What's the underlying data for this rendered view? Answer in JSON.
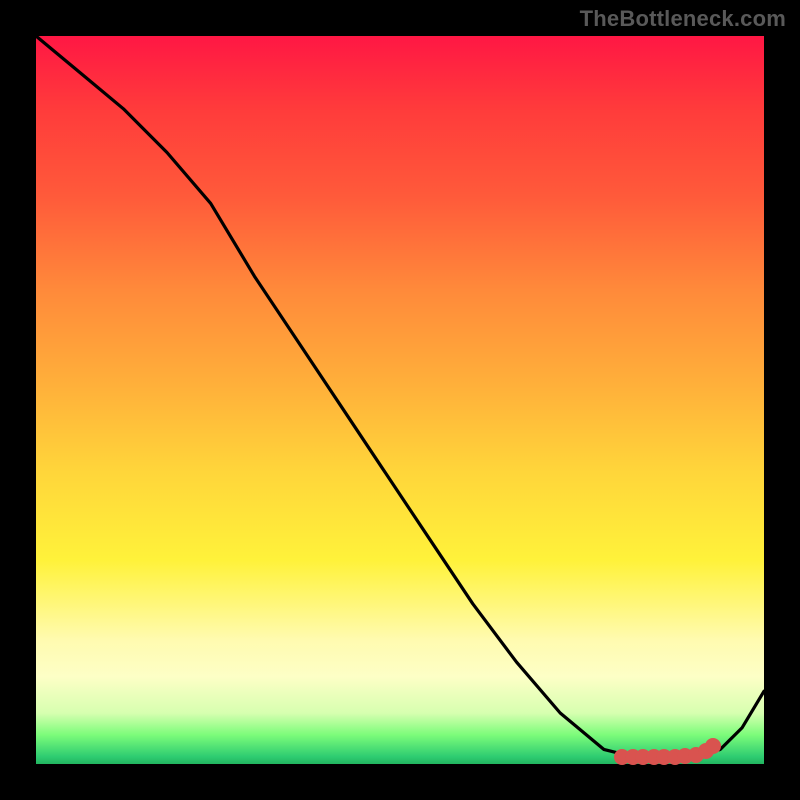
{
  "watermark": "TheBottleneck.com",
  "chart_data": {
    "type": "line",
    "title": "",
    "xlabel": "",
    "ylabel": "",
    "xlim": [
      0,
      100
    ],
    "ylim": [
      0,
      100
    ],
    "x": [
      0,
      6,
      12,
      18,
      24,
      30,
      36,
      42,
      48,
      54,
      60,
      66,
      72,
      78,
      82,
      86,
      90,
      94,
      97,
      100
    ],
    "values": [
      100,
      95,
      90,
      84,
      77,
      67,
      58,
      49,
      40,
      31,
      22,
      14,
      7,
      2,
      1,
      1,
      1,
      2,
      5,
      10
    ],
    "markers_x": [
      80.5,
      82.0,
      83.4,
      84.9,
      86.3,
      87.8,
      89.2,
      90.7,
      92.1,
      93.0
    ],
    "markers_y": [
      1.0,
      1.0,
      1.0,
      1.0,
      1.0,
      1.0,
      1.1,
      1.3,
      1.8,
      2.5
    ],
    "gradient": {
      "top_color": "#ff1744",
      "bottom_color": "#22b45f",
      "description": "vertical red-to-green heat gradient"
    }
  }
}
